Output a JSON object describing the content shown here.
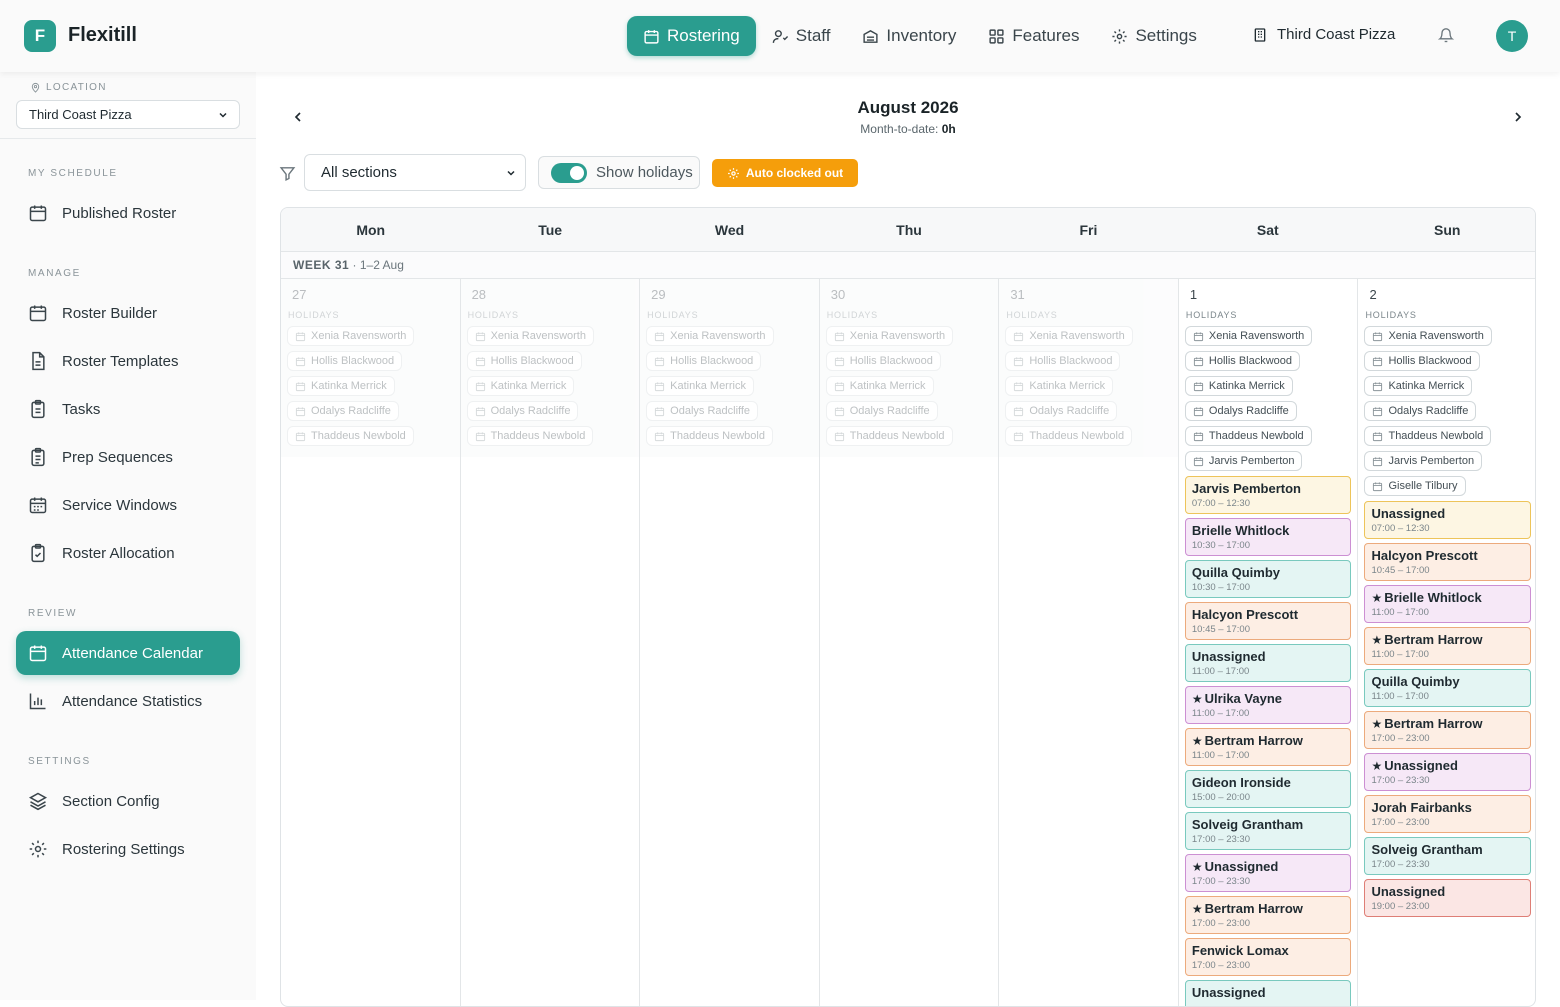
{
  "app": {
    "initial": "F",
    "name": "Flexitill"
  },
  "nav": [
    {
      "label": "Rostering",
      "icon": "calendar-icon",
      "active": true
    },
    {
      "label": "Staff",
      "icon": "staff-icon",
      "active": false
    },
    {
      "label": "Inventory",
      "icon": "inventory-icon",
      "active": false
    },
    {
      "label": "Features",
      "icon": "grid-icon",
      "active": false
    },
    {
      "label": "Settings",
      "icon": "gear-icon",
      "active": false
    }
  ],
  "store": {
    "name": "Third Coast Pizza"
  },
  "user": {
    "initial": "T"
  },
  "sidebar": {
    "location_label": "LOCATION",
    "location_value": "Third Coast Pizza",
    "my_schedule": "MY SCHEDULE",
    "published_roster": "Published Roster",
    "manage": "MANAGE",
    "roster_builder": "Roster Builder",
    "roster_templates": "Roster Templates",
    "tasks": "Tasks",
    "prep_sequences": "Prep Sequences",
    "service_windows": "Service Windows",
    "roster_allocation": "Roster Allocation",
    "review": "REVIEW",
    "attendance_calendar": "Attendance Calendar",
    "attendance_statistics": "Attendance Statistics",
    "settings": "SETTINGS",
    "section_config": "Section Config",
    "rostering_settings": "Rostering Settings"
  },
  "calendar": {
    "month": "August 2026",
    "mtd_label": "Month-to-date:",
    "mtd_value": "0h",
    "sections_value": "All sections",
    "show_holidays": "Show holidays",
    "auto_clocked_out": "Auto clocked out",
    "days": [
      "Mon",
      "Tue",
      "Wed",
      "Thu",
      "Fri",
      "Sat",
      "Sun"
    ],
    "week_label": "WEEK 31",
    "week_range": "· 1–2 Aug",
    "holidays_label": "HOLIDAYS",
    "columns": [
      {
        "date": "27",
        "past": true,
        "holidays": [
          "Xenia Ravensworth",
          "Hollis Blackwood",
          "Katinka Merrick",
          "Odalys Radcliffe",
          "Thaddeus Newbold"
        ],
        "shifts": []
      },
      {
        "date": "28",
        "past": true,
        "holidays": [
          "Xenia Ravensworth",
          "Hollis Blackwood",
          "Katinka Merrick",
          "Odalys Radcliffe",
          "Thaddeus Newbold"
        ],
        "shifts": []
      },
      {
        "date": "29",
        "past": true,
        "holidays": [
          "Xenia Ravensworth",
          "Hollis Blackwood",
          "Katinka Merrick",
          "Odalys Radcliffe",
          "Thaddeus Newbold"
        ],
        "shifts": []
      },
      {
        "date": "30",
        "past": true,
        "holidays": [
          "Xenia Ravensworth",
          "Hollis Blackwood",
          "Katinka Merrick",
          "Odalys Radcliffe",
          "Thaddeus Newbold"
        ],
        "shifts": []
      },
      {
        "date": "31",
        "past": true,
        "holidays": [
          "Xenia Ravensworth",
          "Hollis Blackwood",
          "Katinka Merrick",
          "Odalys Radcliffe",
          "Thaddeus Newbold"
        ],
        "shifts": []
      },
      {
        "date": "1",
        "past": false,
        "holidays": [
          "Xenia Ravensworth",
          "Hollis Blackwood",
          "Katinka Merrick",
          "Odalys Radcliffe",
          "Thaddeus Newbold",
          "Jarvis Pemberton"
        ],
        "shifts": [
          {
            "name": "Jarvis Pemberton",
            "time": "07:00 – 12:30",
            "color": "yellow",
            "star": false
          },
          {
            "name": "Brielle Whitlock",
            "time": "10:30 – 17:00",
            "color": "purple",
            "star": false
          },
          {
            "name": "Quilla Quimby",
            "time": "10:30 – 17:00",
            "color": "teal",
            "star": false
          },
          {
            "name": "Halcyon Prescott",
            "time": "10:45 – 17:00",
            "color": "peach",
            "star": false
          },
          {
            "name": "Unassigned",
            "time": "11:00 – 17:00",
            "color": "teal",
            "star": false
          },
          {
            "name": "Ulrika Vayne",
            "time": "11:00 – 17:00",
            "color": "purple",
            "star": true
          },
          {
            "name": "Bertram Harrow",
            "time": "11:00 – 17:00",
            "color": "peach",
            "star": true
          },
          {
            "name": "Gideon Ironside",
            "time": "15:00 – 20:00",
            "color": "teal",
            "star": false
          },
          {
            "name": "Solveig Grantham",
            "time": "17:00 – 23:30",
            "color": "teal",
            "star": false
          },
          {
            "name": "Unassigned",
            "time": "17:00 – 23:30",
            "color": "purple",
            "star": true
          },
          {
            "name": "Bertram Harrow",
            "time": "17:00 – 23:00",
            "color": "peach",
            "star": true
          },
          {
            "name": "Fenwick Lomax",
            "time": "17:00 – 23:00",
            "color": "peach",
            "star": false
          },
          {
            "name": "Unassigned",
            "time": "",
            "color": "teal",
            "star": false
          }
        ]
      },
      {
        "date": "2",
        "past": false,
        "holidays": [
          "Xenia Ravensworth",
          "Hollis Blackwood",
          "Katinka Merrick",
          "Odalys Radcliffe",
          "Thaddeus Newbold",
          "Jarvis Pemberton",
          "Giselle Tilbury"
        ],
        "shifts": [
          {
            "name": "Unassigned",
            "time": "07:00 – 12:30",
            "color": "yellow",
            "star": false
          },
          {
            "name": "Halcyon Prescott",
            "time": "10:45 – 17:00",
            "color": "peach",
            "star": false
          },
          {
            "name": "Brielle Whitlock",
            "time": "11:00 – 17:00",
            "color": "purple",
            "star": true
          },
          {
            "name": "Bertram Harrow",
            "time": "11:00 – 17:00",
            "color": "peach",
            "star": true
          },
          {
            "name": "Quilla Quimby",
            "time": "11:00 – 17:00",
            "color": "teal",
            "star": false
          },
          {
            "name": "Bertram Harrow",
            "time": "17:00 – 23:00",
            "color": "peach",
            "star": true
          },
          {
            "name": "Unassigned",
            "time": "17:00 – 23:30",
            "color": "purple",
            "star": true
          },
          {
            "name": "Jorah Fairbanks",
            "time": "17:00 – 23:00",
            "color": "peach",
            "star": false
          },
          {
            "name": "Solveig Grantham",
            "time": "17:00 – 23:30",
            "color": "teal",
            "star": false
          },
          {
            "name": "Unassigned",
            "time": "19:00 – 23:00",
            "color": "red",
            "star": false
          }
        ]
      }
    ]
  },
  "colors": {
    "accent": "#2a9d8f",
    "warning": "#f59e0b"
  }
}
